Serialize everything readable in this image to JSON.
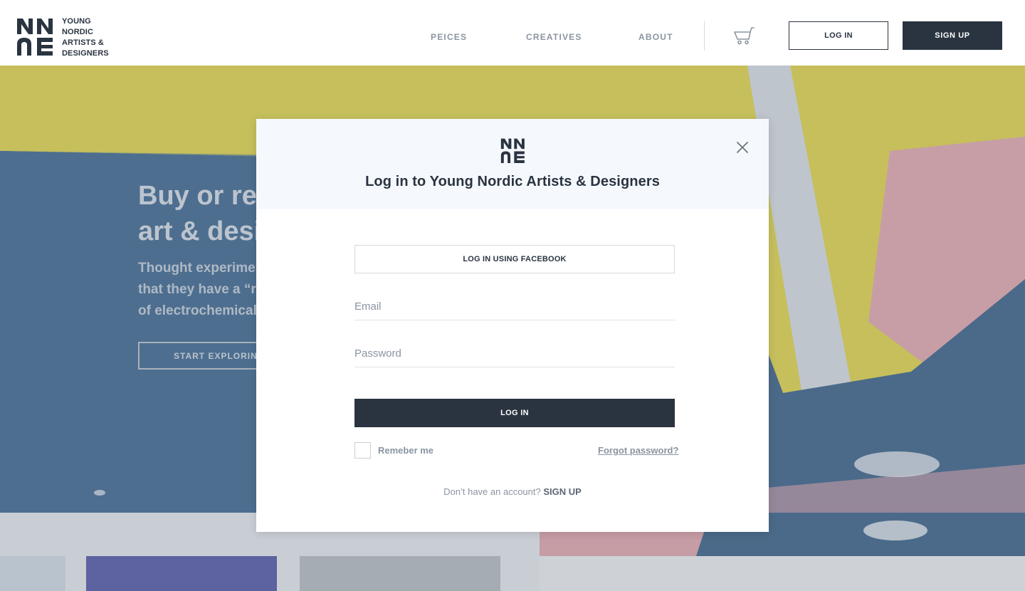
{
  "brand": {
    "lines": [
      "YOUNG",
      "NORDIC",
      "ARTISTS &",
      "DESIGNERS"
    ],
    "logo_icon": "ynad-logo-icon",
    "primary_color": "#2a3441",
    "muted_color": "#8a94a1"
  },
  "nav": {
    "items": [
      {
        "label": "PEICES"
      },
      {
        "label": "CREATIVES"
      },
      {
        "label": "ABOUT"
      }
    ],
    "cart_icon": "cart-icon",
    "login_label": "LOG IN",
    "signup_label": "SIGN  UP"
  },
  "hero": {
    "title_lines": [
      "Buy or ren",
      "art & desi"
    ],
    "subtitle_lines": [
      "Thought experimen",
      "that they have a “re",
      "of electrochemical a"
    ],
    "cta_label": "START EXPLORING"
  },
  "modal": {
    "logo_icon": "ynad-logo-icon",
    "title": "Log in to Young Nordic Artists & Designers",
    "close_icon": "close-icon",
    "facebook_label": "LOG IN USING FACEBOOK",
    "email": {
      "placeholder": "Email",
      "value": ""
    },
    "password": {
      "placeholder": "Password",
      "value": ""
    },
    "submit_label": "LOG IN",
    "remember_label": "Remeber me",
    "remember_checked": false,
    "forgot_label": "Forgot password?",
    "signup_prompt": "Don’t have an account?",
    "signup_link": "SIGN UP"
  }
}
